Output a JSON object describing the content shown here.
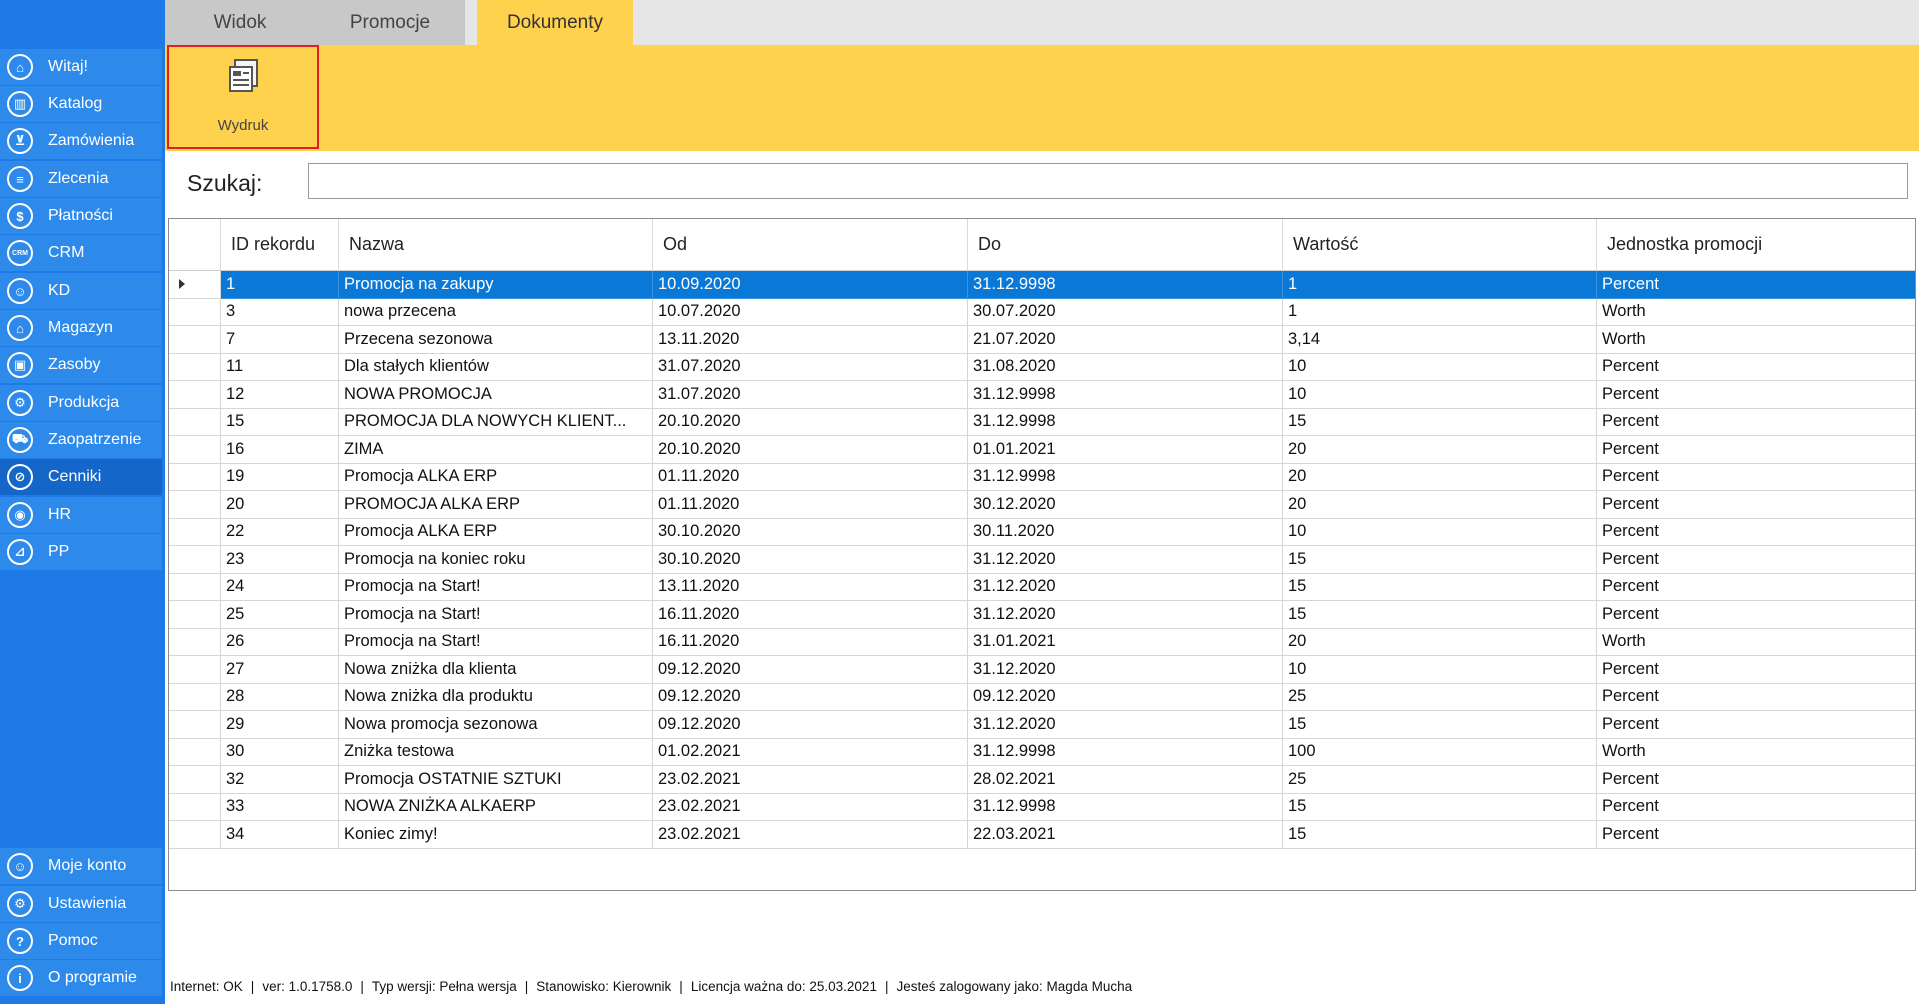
{
  "tabs": [
    "Widok",
    "Promocje",
    "Dokumenty"
  ],
  "ribbon": {
    "print_label": "Wydruk"
  },
  "sidebar": {
    "items": [
      "Witaj!",
      "Katalog",
      "Zamówienia",
      "Zlecenia",
      "Płatności",
      "CRM",
      "KD",
      "Magazyn",
      "Zasoby",
      "Produkcja",
      "Zaopatrzenie",
      "Cenniki",
      "HR",
      "PP"
    ],
    "bottom_items": [
      "Moje konto",
      "Ustawienia",
      "Pomoc",
      "O programie"
    ]
  },
  "search": {
    "label": "Szukaj:",
    "value": "",
    "placeholder": ""
  },
  "table": {
    "columns": [
      "ID rekordu",
      "Nazwa",
      "Od",
      "Do",
      "Wartość",
      "Jednostka promocji"
    ],
    "rows": [
      [
        "1",
        "Promocja na zakupy",
        "10.09.2020",
        "31.12.9998",
        "1",
        "Percent"
      ],
      [
        "3",
        "nowa przecena",
        "10.07.2020",
        "30.07.2020",
        "1",
        "Worth"
      ],
      [
        "7",
        "Przecena sezonowa",
        "13.11.2020",
        "21.07.2020",
        "3,14",
        "Worth"
      ],
      [
        "11",
        "Dla stałych klientów",
        "31.07.2020",
        "31.08.2020",
        "10",
        "Percent"
      ],
      [
        "12",
        "NOWA PROMOCJA",
        "31.07.2020",
        "31.12.9998",
        "10",
        "Percent"
      ],
      [
        "15",
        "PROMOCJA DLA NOWYCH KLIENT...",
        "20.10.2020",
        "31.12.9998",
        "15",
        "Percent"
      ],
      [
        "16",
        "ZIMA",
        "20.10.2020",
        "01.01.2021",
        "20",
        "Percent"
      ],
      [
        "19",
        "Promocja ALKA ERP",
        "01.11.2020",
        "31.12.9998",
        "20",
        "Percent"
      ],
      [
        "20",
        "PROMOCJA ALKA ERP",
        "01.11.2020",
        "30.12.2020",
        "20",
        "Percent"
      ],
      [
        "22",
        "Promocja ALKA ERP",
        "30.10.2020",
        "30.11.2020",
        "10",
        "Percent"
      ],
      [
        "23",
        "Promocja na koniec roku",
        "30.10.2020",
        "31.12.2020",
        "15",
        "Percent"
      ],
      [
        "24",
        "Promocja na Start!",
        "13.11.2020",
        "31.12.2020",
        "15",
        "Percent"
      ],
      [
        "25",
        "Promocja na Start!",
        "16.11.2020",
        "31.12.2020",
        "15",
        "Percent"
      ],
      [
        "26",
        "Promocja na Start!",
        "16.11.2020",
        "31.01.2021",
        "20",
        "Worth"
      ],
      [
        "27",
        "Nowa zniżka dla klienta",
        "09.12.2020",
        "31.12.2020",
        "10",
        "Percent"
      ],
      [
        "28",
        "Nowa zniżka dla produktu",
        "09.12.2020",
        "09.12.2020",
        "25",
        "Percent"
      ],
      [
        "29",
        "Nowa promocja sezonowa",
        "09.12.2020",
        "31.12.2020",
        "15",
        "Percent"
      ],
      [
        "30",
        "Zniżka testowa",
        "01.02.2021",
        "31.12.9998",
        "100",
        "Worth"
      ],
      [
        "32",
        "Promocja OSTATNIE SZTUKI",
        "23.02.2021",
        "28.02.2021",
        "25",
        "Percent"
      ],
      [
        "33",
        "NOWA ZNIŻKA ALKAERP",
        "23.02.2021",
        "31.12.9998",
        "15",
        "Percent"
      ],
      [
        "34",
        "Koniec zimy!",
        "23.02.2021",
        "22.03.2021",
        "15",
        "Percent"
      ]
    ]
  },
  "status": {
    "internet": "Internet: OK",
    "version": "ver: 1.0.1758.0",
    "type": "Typ wersji: Pełna wersja",
    "position": "Stanowisko: Kierownik",
    "license": "Licencja ważna do: 25.03.2021",
    "user": "Jesteś zalogowany jako: Magda Mucha"
  },
  "colors": {
    "sidebar": "#1e7ae6",
    "ribbon": "#ffd24e",
    "selected_row": "#0a78d7",
    "highlight_border": "#e02020"
  }
}
